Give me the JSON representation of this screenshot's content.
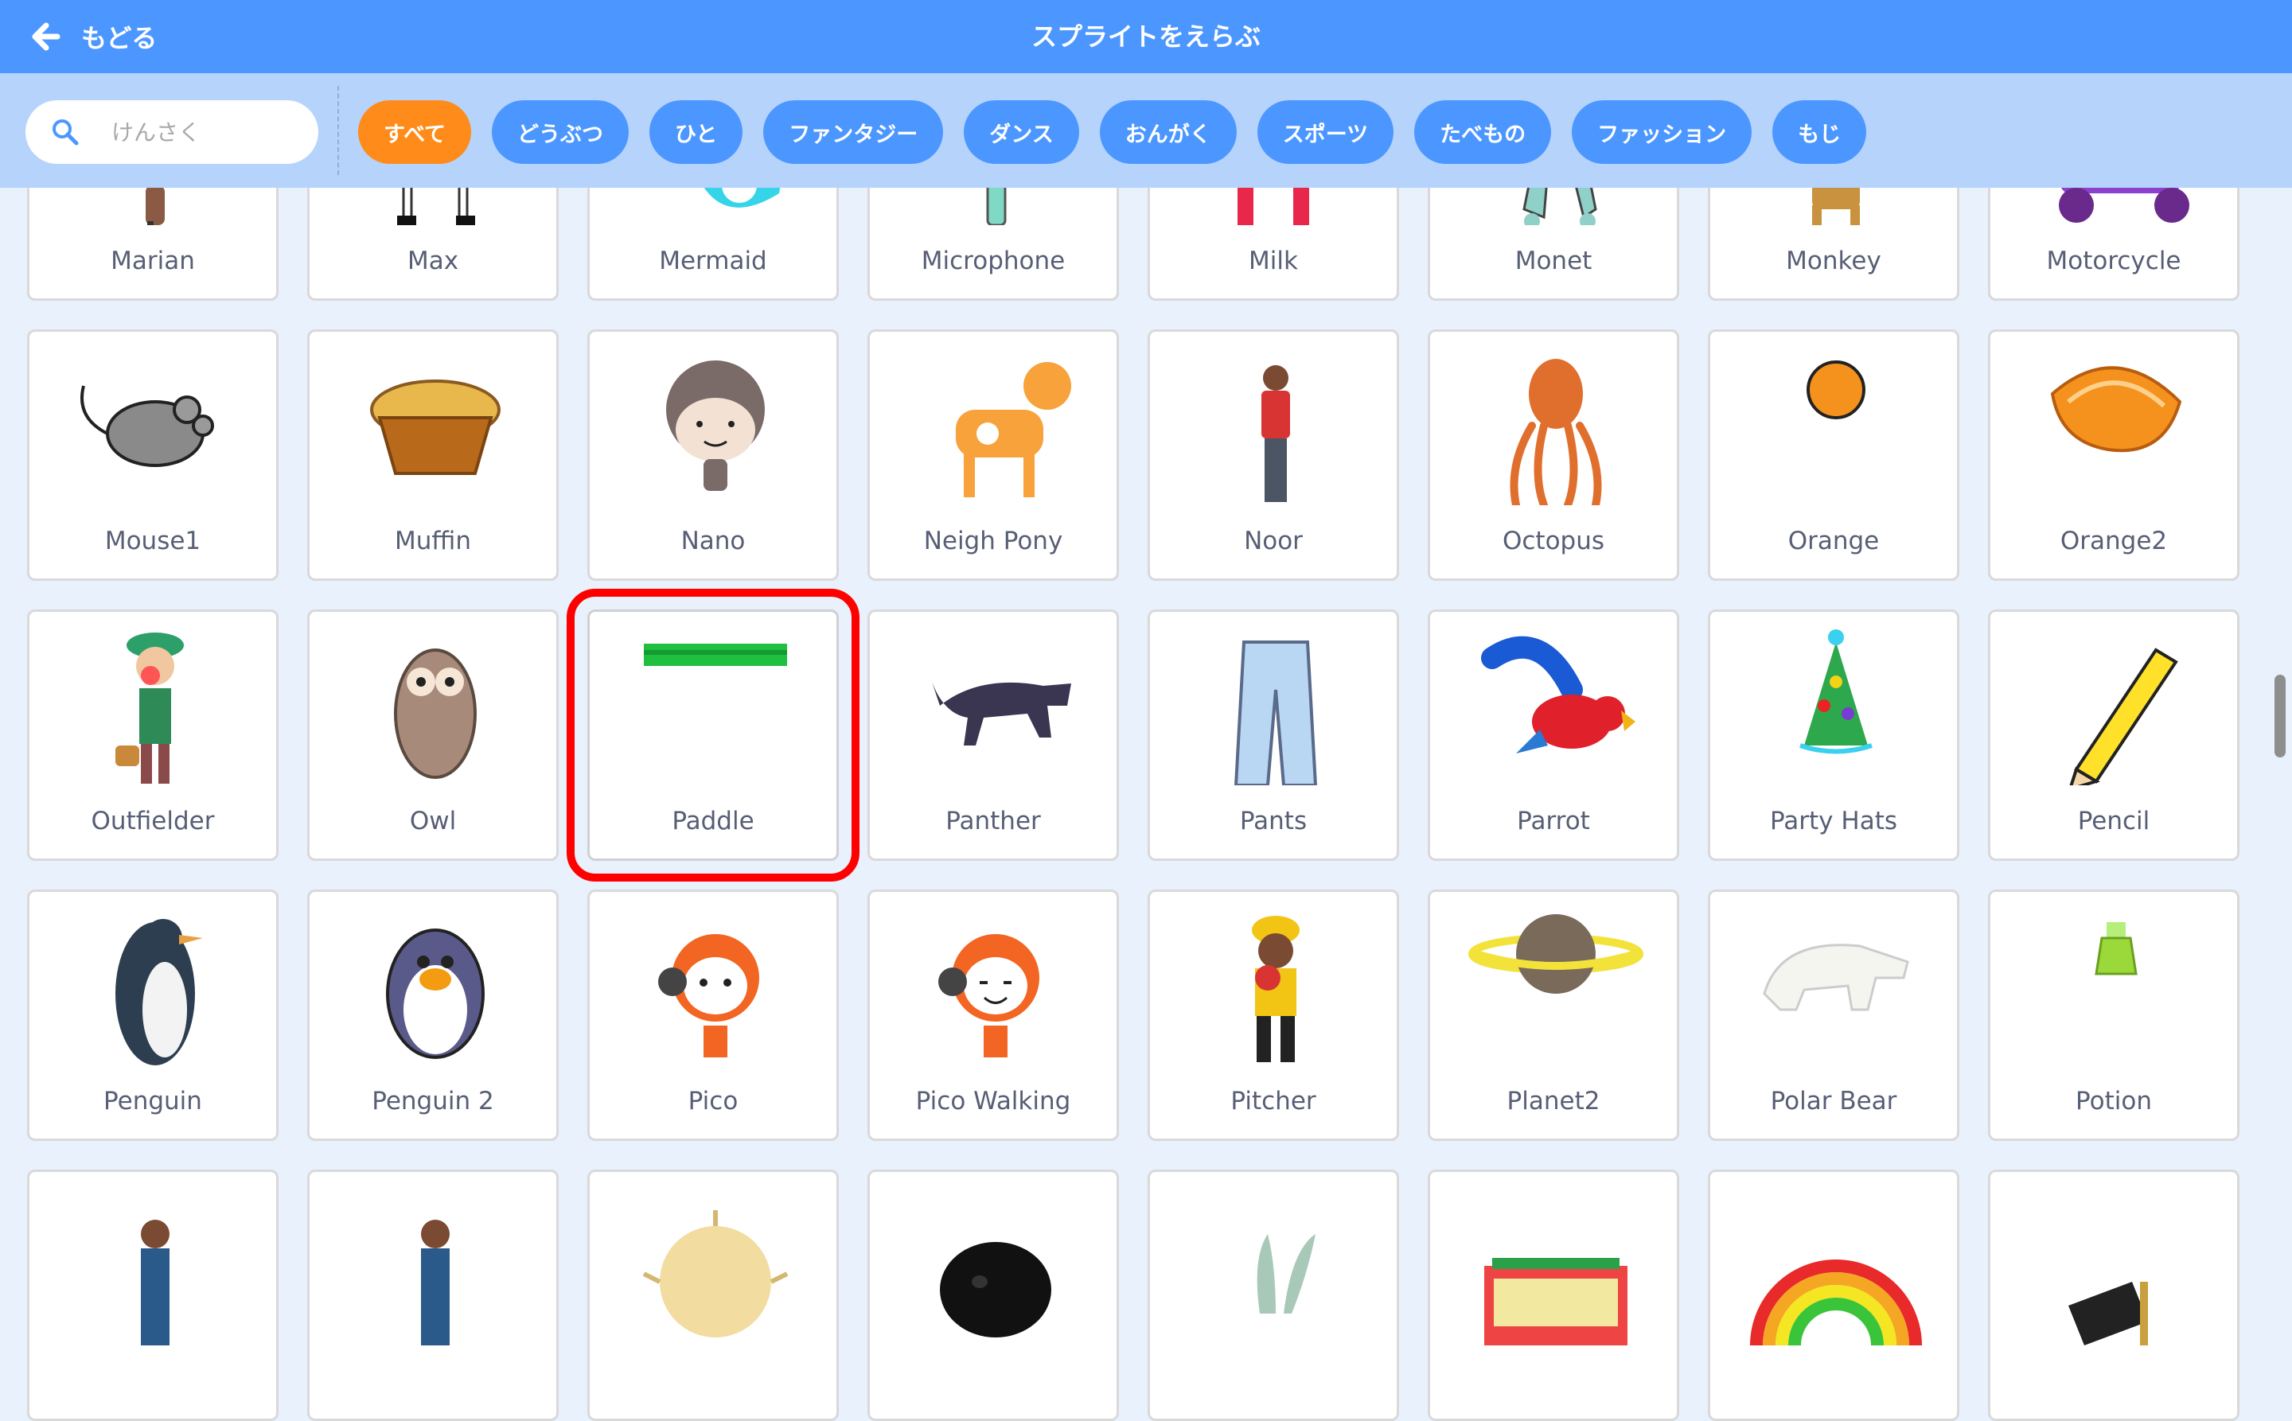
{
  "header": {
    "back_label": "もどる",
    "title": "スプライトをえらぶ"
  },
  "search": {
    "placeholder": "けんさく"
  },
  "tags": [
    {
      "label": "すべて",
      "active": true
    },
    {
      "label": "どうぶつ",
      "active": false
    },
    {
      "label": "ひと",
      "active": false
    },
    {
      "label": "ファンタジー",
      "active": false
    },
    {
      "label": "ダンス",
      "active": false
    },
    {
      "label": "おんがく",
      "active": false
    },
    {
      "label": "スポーツ",
      "active": false
    },
    {
      "label": "たべもの",
      "active": false
    },
    {
      "label": "ファッション",
      "active": false
    },
    {
      "label": "もじ",
      "active": false
    }
  ],
  "sprites": [
    {
      "name": "Marian",
      "icon": "marian-icon"
    },
    {
      "name": "Max",
      "icon": "max-icon"
    },
    {
      "name": "Mermaid",
      "icon": "mermaid-icon"
    },
    {
      "name": "Microphone",
      "icon": "microphone-icon"
    },
    {
      "name": "Milk",
      "icon": "milk-icon"
    },
    {
      "name": "Monet",
      "icon": "monet-icon"
    },
    {
      "name": "Monkey",
      "icon": "monkey-icon"
    },
    {
      "name": "Motorcycle",
      "icon": "motorcycle-icon"
    },
    {
      "name": "Mouse1",
      "icon": "mouse-icon"
    },
    {
      "name": "Muffin",
      "icon": "muffin-icon"
    },
    {
      "name": "Nano",
      "icon": "nano-icon"
    },
    {
      "name": "Neigh Pony",
      "icon": "pony-icon"
    },
    {
      "name": "Noor",
      "icon": "noor-icon"
    },
    {
      "name": "Octopus",
      "icon": "octopus-icon"
    },
    {
      "name": "Orange",
      "icon": "orange-icon"
    },
    {
      "name": "Orange2",
      "icon": "orange-slice-icon"
    },
    {
      "name": "Outfielder",
      "icon": "outfielder-icon"
    },
    {
      "name": "Owl",
      "icon": "owl-icon"
    },
    {
      "name": "Paddle",
      "icon": "paddle-icon",
      "highlighted": true
    },
    {
      "name": "Panther",
      "icon": "panther-icon"
    },
    {
      "name": "Pants",
      "icon": "pants-icon"
    },
    {
      "name": "Parrot",
      "icon": "parrot-icon"
    },
    {
      "name": "Party Hats",
      "icon": "party-hat-icon"
    },
    {
      "name": "Pencil",
      "icon": "pencil-icon"
    },
    {
      "name": "Penguin",
      "icon": "penguin-icon"
    },
    {
      "name": "Penguin 2",
      "icon": "penguin2-icon"
    },
    {
      "name": "Pico",
      "icon": "pico-icon"
    },
    {
      "name": "Pico Walking",
      "icon": "pico-walking-icon"
    },
    {
      "name": "Pitcher",
      "icon": "pitcher-icon"
    },
    {
      "name": "Planet2",
      "icon": "planet-icon"
    },
    {
      "name": "Polar Bear",
      "icon": "polar-bear-icon"
    },
    {
      "name": "Potion",
      "icon": "potion-icon"
    },
    {
      "name": "",
      "icon": "person-icon"
    },
    {
      "name": "",
      "icon": "person-icon"
    },
    {
      "name": "",
      "icon": "pufferfish-icon"
    },
    {
      "name": "",
      "icon": "puppy-icon"
    },
    {
      "name": "",
      "icon": "rabbit-icon"
    },
    {
      "name": "",
      "icon": "radio-icon"
    },
    {
      "name": "",
      "icon": "rainbow-icon"
    },
    {
      "name": "",
      "icon": "flag-icon"
    }
  ],
  "colors": {
    "header": "#4c97ff",
    "filter_bar": "#b6d3fc",
    "active_tag": "#ff8c1a",
    "tag": "#4c97ff",
    "highlight": "#ff0000",
    "background": "#e9f1fc"
  }
}
